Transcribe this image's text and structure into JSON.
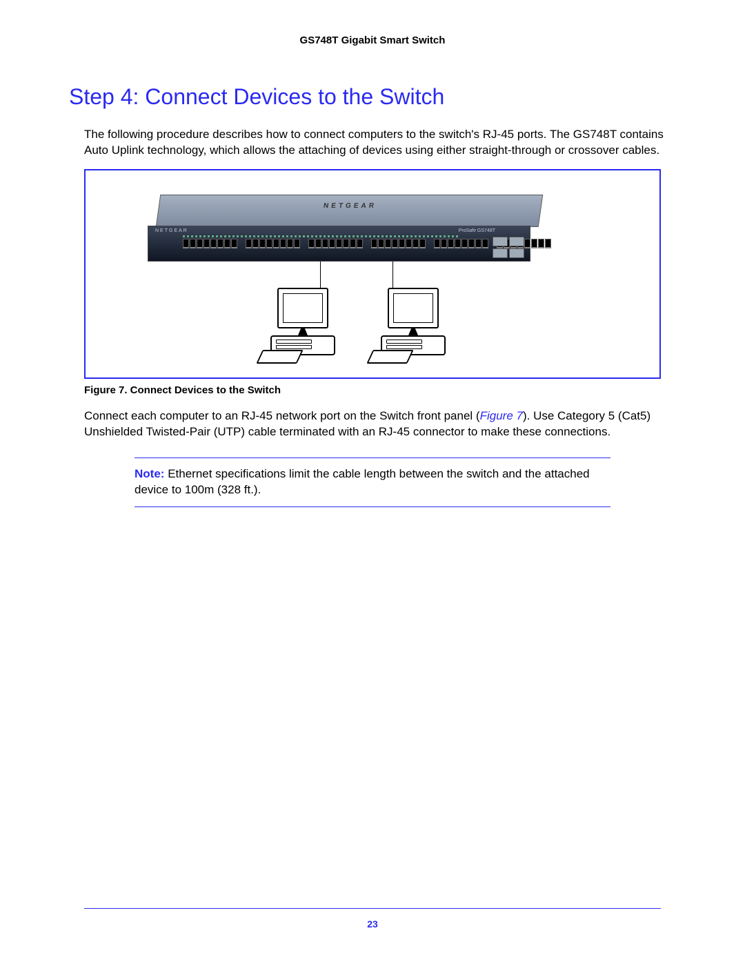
{
  "header": {
    "title": "GS748T Gigabit Smart Switch"
  },
  "section": {
    "heading": "Step 4: Connect Devices to the Switch",
    "intro": "The following procedure describes how to connect computers to the switch's RJ-45 ports. The GS748T contains Auto Uplink technology, which allows the attaching of devices using either straight-through or crossover cables."
  },
  "figure": {
    "caption": "Figure 7. Connect Devices to the Switch",
    "brand": "NETGEAR",
    "model_label": "ProSafe GS748T"
  },
  "para2": {
    "before_ref": "Connect each computer to an RJ-45 network port on the Switch front panel (",
    "ref": "Figure 7",
    "after_ref": "). Use Category 5 (Cat5) Unshielded Twisted-Pair (UTP) cable terminated with an RJ-45 connector to make these connections."
  },
  "note": {
    "label": "Note:",
    "text": "Ethernet specifications limit the cable length between the switch and the attached device to 100m (328 ft.)."
  },
  "footer": {
    "page_number": "23"
  }
}
